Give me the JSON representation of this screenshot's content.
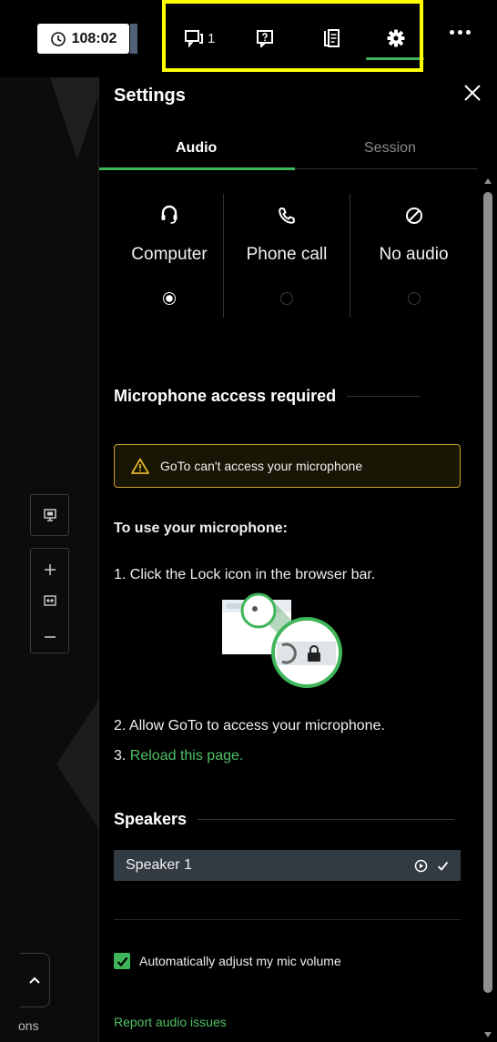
{
  "topbar": {
    "timer": "108:02",
    "chat_count": "1"
  },
  "settings": {
    "title": "Settings",
    "tabs": [
      "Audio",
      "Session"
    ],
    "audio_options": [
      {
        "label": "Computer",
        "icon": "headset-icon",
        "selected": true
      },
      {
        "label": "Phone call",
        "icon": "phone-icon",
        "selected": false
      },
      {
        "label": "No audio",
        "icon": "no-audio-icon",
        "selected": false
      }
    ],
    "mic_heading": "Microphone access required",
    "warning": "GoTo can't access your microphone",
    "instructions_heading": "To use your microphone:",
    "step1": "1. Click the Lock icon in the browser bar.",
    "step2": "2. Allow GoTo to access your microphone.",
    "step3_prefix": "3. ",
    "step3_link": "Reload this page.",
    "speakers_heading": "Speakers",
    "speaker": "Speaker 1",
    "auto_adjust": "Automatically adjust my mic volume",
    "auto_adjust_checked": true,
    "report_link": "Report audio issues"
  },
  "left_panel": {
    "partial_label": "ons"
  },
  "colors": {
    "accent": "#3fb55a",
    "warning_border": "#c9a227",
    "highlight": "#ffff00"
  }
}
